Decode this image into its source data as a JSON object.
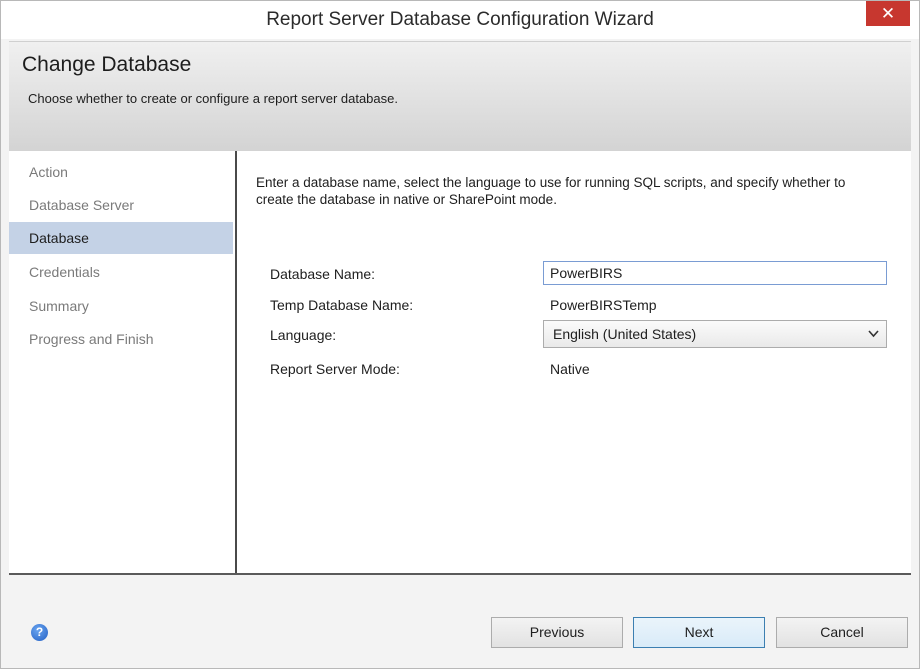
{
  "window": {
    "title": "Report Server Database Configuration Wizard",
    "close_glyph": "✕"
  },
  "header": {
    "title": "Change Database",
    "subtitle": "Choose whether to create or configure a report server database."
  },
  "sidebar": {
    "items": [
      {
        "label": "Action"
      },
      {
        "label": "Database Server"
      },
      {
        "label": "Database"
      },
      {
        "label": "Credentials"
      },
      {
        "label": "Summary"
      },
      {
        "label": "Progress and Finish"
      }
    ],
    "active_item": "Database"
  },
  "main": {
    "intro": "Enter a database name, select the language to use for running SQL scripts, and specify whether to create the database in native or SharePoint mode.",
    "fields": {
      "database_name_label": "Database Name:",
      "database_name_value": "PowerBIRS",
      "temp_db_label": "Temp Database Name:",
      "temp_db_value": "PowerBIRSTemp",
      "language_label": "Language:",
      "language_value": "English (United States)",
      "mode_label": "Report Server Mode:",
      "mode_value": "Native"
    }
  },
  "footer": {
    "help_glyph": "?",
    "previous": "Previous",
    "next": "Next",
    "cancel": "Cancel"
  },
  "colors": {
    "selection": "#c4d2e6",
    "close": "#c7372f",
    "accent_border": "#3c7fb1"
  },
  "icons": {
    "close": "close-icon",
    "help": "help-icon",
    "dropdown": "chevron-down-icon"
  }
}
